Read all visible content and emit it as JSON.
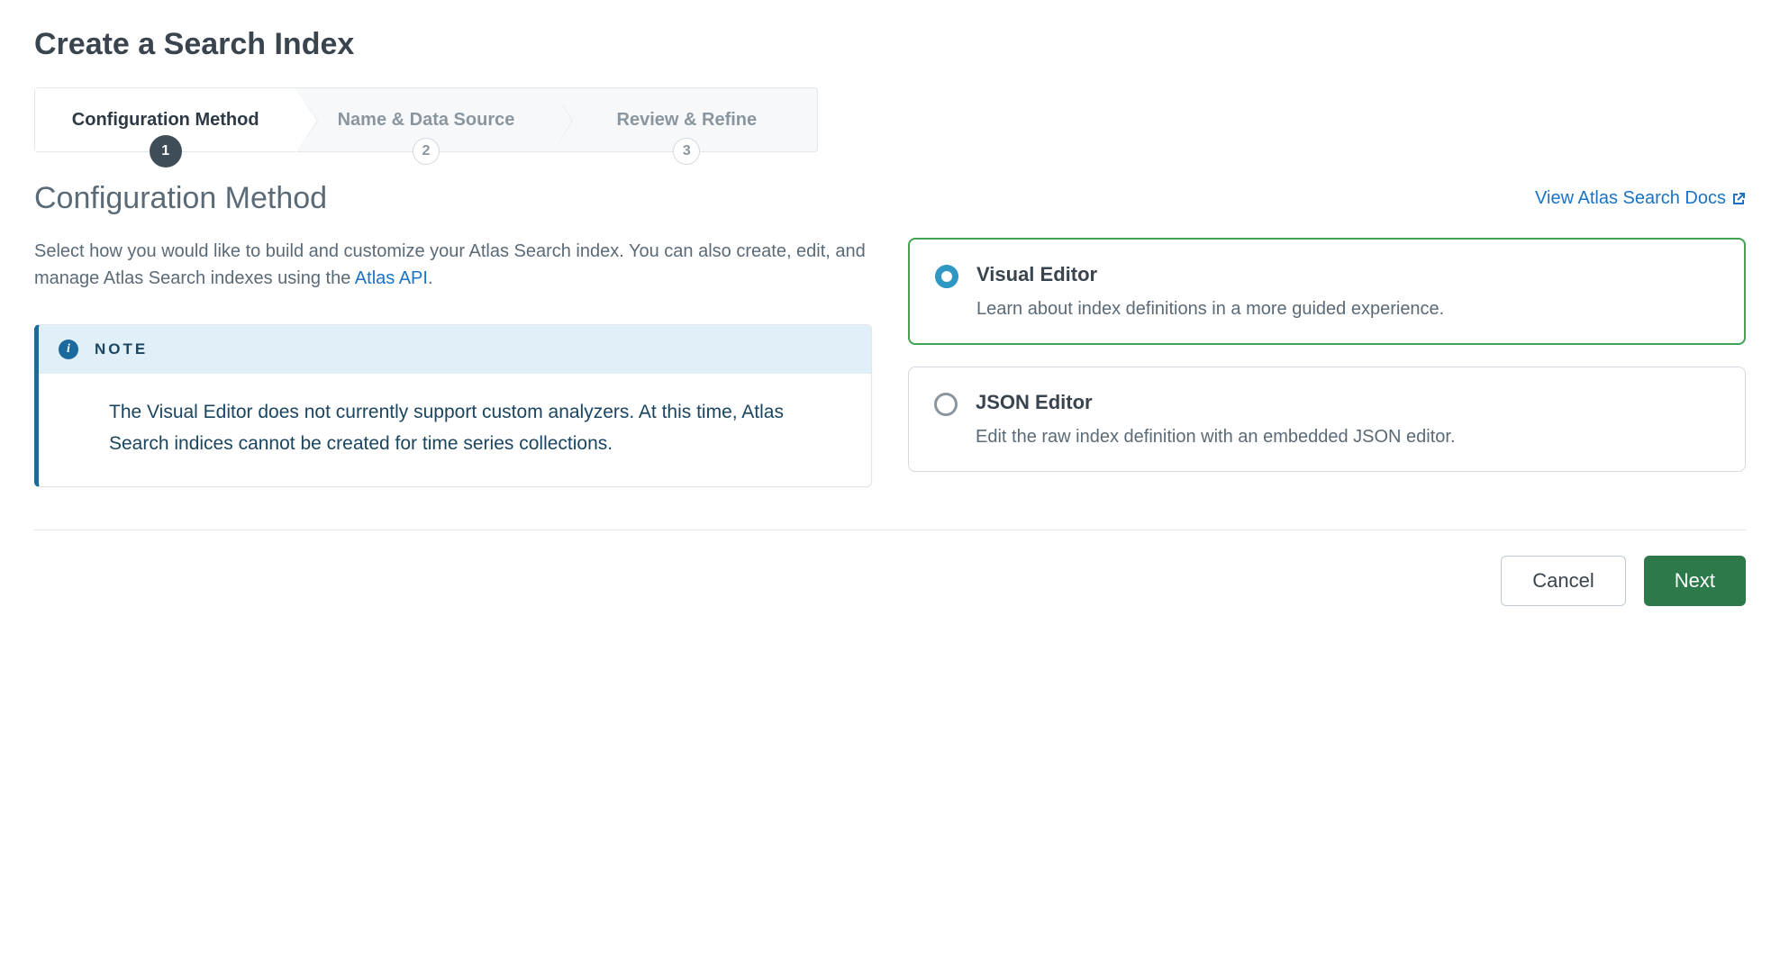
{
  "page_title": "Create a Search Index",
  "stepper": {
    "steps": [
      {
        "label": "Configuration Method",
        "num": "1"
      },
      {
        "label": "Name & Data Source",
        "num": "2"
      },
      {
        "label": "Review & Refine",
        "num": "3"
      }
    ]
  },
  "section_title": "Configuration Method",
  "docs_link_label": "View Atlas Search Docs",
  "intro": {
    "text_before": "Select how you would like to build and customize your Atlas Search index. You can also create, edit, and manage Atlas Search indexes using the ",
    "link_label": "Atlas API",
    "text_after": "."
  },
  "note": {
    "label": "NOTE",
    "body": "The Visual Editor does not currently support custom analyzers. At this time, Atlas Search indices cannot be created for time series collections."
  },
  "options": {
    "visual": {
      "title": "Visual Editor",
      "desc": "Learn about index definitions in a more guided experience."
    },
    "json": {
      "title": "JSON Editor",
      "desc": "Edit the raw index definition with an embedded JSON editor."
    }
  },
  "footer": {
    "cancel": "Cancel",
    "next": "Next"
  }
}
